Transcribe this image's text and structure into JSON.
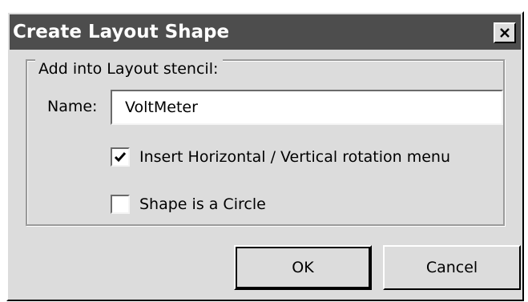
{
  "window": {
    "title": "Create Layout Shape",
    "close_glyph": "✕"
  },
  "group": {
    "legend": "Add into Layout stencil:"
  },
  "name_field": {
    "label": "Name:",
    "value": "VoltMeter"
  },
  "options": [
    {
      "label": "Insert Horizontal / Vertical rotation menu",
      "checked": true
    },
    {
      "label": "Shape is a Circle",
      "checked": false
    }
  ],
  "buttons": {
    "ok": "OK",
    "cancel": "Cancel"
  },
  "colors": {
    "titlebar": "#4d4d4d",
    "dialog_face": "#dcdcdc",
    "input_bg": "#ffffff"
  }
}
